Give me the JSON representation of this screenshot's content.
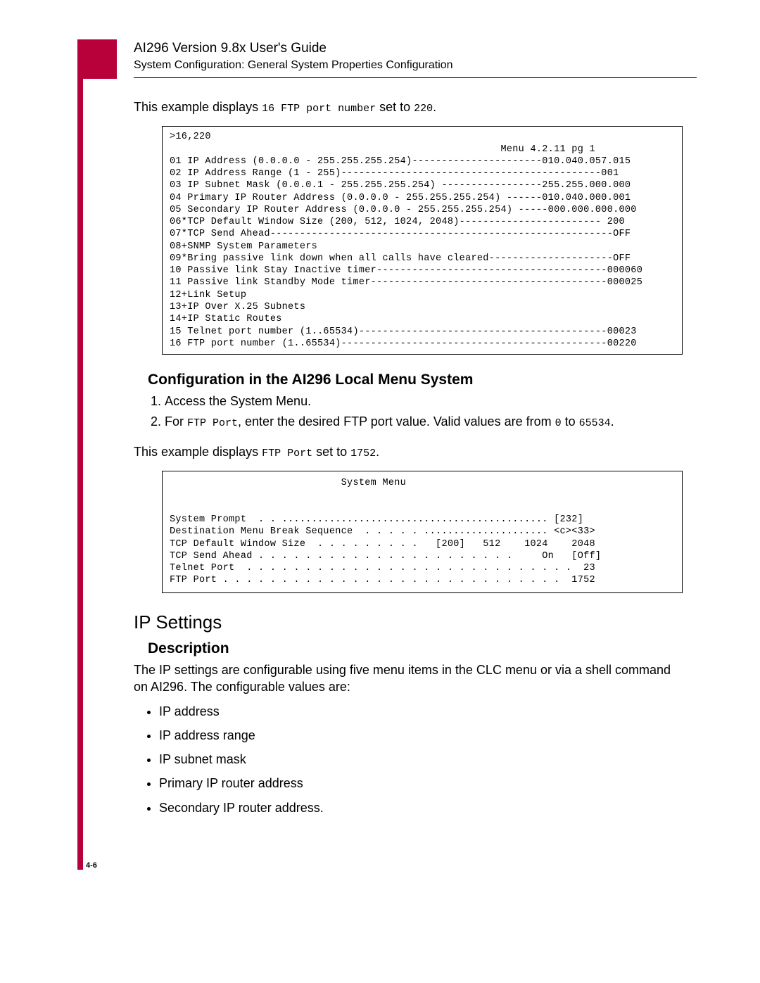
{
  "header": {
    "title": "AI296 Version 9.8x User's Guide",
    "subtitle": "System Configuration: General System Properties Configuration"
  },
  "intro1": {
    "pre": "This example displays ",
    "mono1": "16 FTP port number",
    "mid": " set to ",
    "mono2": "220",
    "post": "."
  },
  "codebox1": ">16,220\n                                                        Menu 4.2.11 pg 1\n01 IP Address (0.0.0.0 - 255.255.255.254)----------------------010.040.057.015\n02 IP Address Range (1 - 255)--------------------------------------------001\n03 IP Subnet Mask (0.0.0.1 - 255.255.255.254) -----------------255.255.000.000\n04 Primary IP Router Address (0.0.0.0 - 255.255.255.254) ------010.040.000.001\n05 Secondary IP Router Address (0.0.0.0 - 255.255.255.254) -----000.000.000.000\n06*TCP Default Window Size (200, 512, 1024, 2048)------------------------ 200\n07*TCP Send Ahead----------------------------------------------------------OFF\n08+SNMP System Parameters\n09*Bring passive link down when all calls have cleared---------------------OFF\n10 Passive link Stay Inactive timer---------------------------------------000060\n11 Passive link Standby Mode timer----------------------------------------000025\n12+Link Setup\n13+IP Over X.25 Subnets\n14+IP Static Routes\n15 Telnet port number (1..65534)------------------------------------------00023\n16 FTP port number (1..65534)---------------------------------------------00220",
  "section1": {
    "heading": "Configuration in the AI296 Local Menu System",
    "step1": "Access the System Menu.",
    "step2_pre": "For ",
    "step2_mono1": "FTP Port",
    "step2_mid": ", enter the desired FTP port value. Valid values are from ",
    "step2_mono2": "0",
    "step2_mid2": " to ",
    "step2_mono3": "65534",
    "step2_post": "."
  },
  "intro2": {
    "pre": "This example displays ",
    "mono1": "FTP Port",
    "mid": " set to ",
    "mono2": "1752",
    "post": "."
  },
  "sysbox": "                             System Menu\n\n\nSystem Prompt  . . ............................................. [232]\nDestination Menu Break Sequence  . . . . . ..................... <c><33>\nTCP Default Window Size  . . . . . . . . .   [200]   512    1024    2048\nTCP Send Ahead . . . . . . . . . . . . . . . . . . . . . .     On   [Off]\nTelnet Port  . . . . . . . . . . . . . . . . . . . . . . . . . . . .  23\nFTP Port . . . . . . . . . . . . . . . . . . . . . . . . . . . . .  1752",
  "section2": {
    "heading": "IP Settings",
    "sub": "Description",
    "para": "The IP settings are configurable using five menu items in the CLC menu or via a shell command on AI296. The configurable values are:",
    "items": {
      "0": "IP address",
      "1": "IP address range",
      "2": "IP subnet mask",
      "3": "Primary IP router address",
      "4": "Secondary IP router address."
    }
  },
  "pagenum": "4-6"
}
